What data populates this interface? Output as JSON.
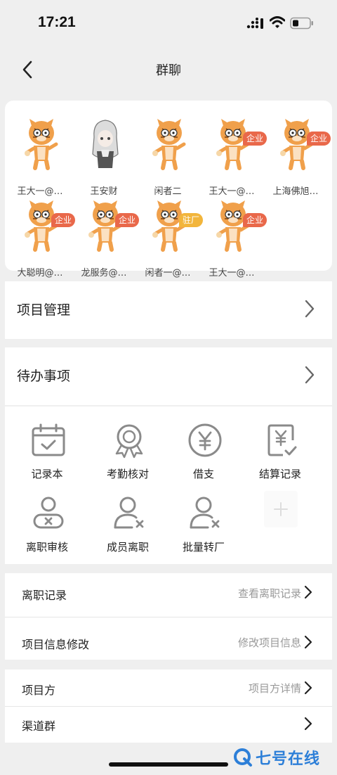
{
  "status_bar": {
    "time": "17:21"
  },
  "nav": {
    "title": "群聊"
  },
  "members": [
    {
      "name": "王大一@…",
      "badge": ""
    },
    {
      "name": "王安财",
      "badge": ""
    },
    {
      "name": "闲者二",
      "badge": ""
    },
    {
      "name": "王大一@…",
      "badge": "企业"
    },
    {
      "name": "上海佛旭…",
      "badge": "企业"
    },
    {
      "name": "大聪明@…",
      "badge": "企业"
    },
    {
      "name": "龙服务@…",
      "badge": "企业"
    },
    {
      "name": "闲者一@…",
      "badge": "驻厂"
    },
    {
      "name": "王大一@…",
      "badge": "企业"
    }
  ],
  "project_management": {
    "label": "项目管理"
  },
  "todo": {
    "label": "待办事项"
  },
  "tools": [
    {
      "label": "记录本",
      "icon": "calendar-check-icon"
    },
    {
      "label": "考勤核对",
      "icon": "award-ribbon-icon"
    },
    {
      "label": "借支",
      "icon": "yen-circle-icon"
    },
    {
      "label": "结算记录",
      "icon": "yen-document-check-icon"
    },
    {
      "label": "离职审核",
      "icon": "user-review-x-icon"
    },
    {
      "label": "成员离职",
      "icon": "user-remove-icon"
    },
    {
      "label": "批量转厂",
      "icon": "user-transfer-icon"
    }
  ],
  "resign_record": {
    "label": "离职记录",
    "value": "查看离职记录"
  },
  "project_info": {
    "label": "项目信息修改",
    "value": "修改项目信息"
  },
  "project_party": {
    "label": "项目方",
    "value": "项目方详情"
  },
  "channel_group": {
    "label": "渠道群"
  },
  "watermark": {
    "text": "七号在线"
  },
  "colors": {
    "badge_company": "#e9684a",
    "badge_onsite": "#f2b53b",
    "icon_gray": "#8a8a8a",
    "watermark": "#2d7fd8"
  }
}
